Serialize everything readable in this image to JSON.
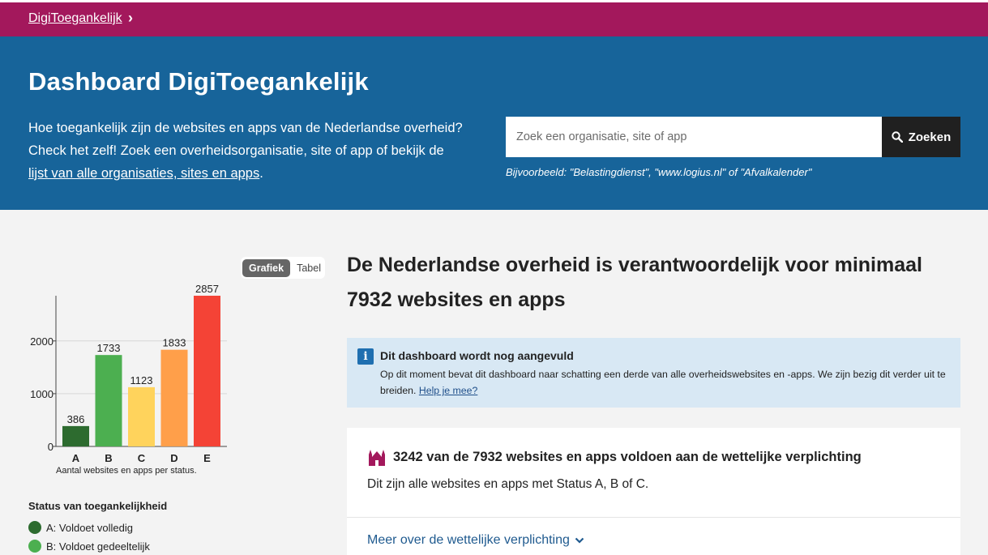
{
  "breadcrumb": {
    "label": "DigiToegankelijk",
    "chevron": "›"
  },
  "hero": {
    "title": "Dashboard DigiToegankelijk",
    "text_before": "Hoe toegankelijk zijn de websites en apps van de Nederlandse overheid? Check het zelf! Zoek een overheidsorganisatie, site of app of bekijk de ",
    "link": "lijst van alle organisaties, sites en apps",
    "text_after": ".",
    "search_placeholder": "Zoek een organisatie, site of app",
    "search_button": "Zoeken",
    "search_example": "Bijvoorbeeld: \"Belastingdienst\", \"www.logius.nl\" of \"Afvalkalender\""
  },
  "view_toggle": {
    "active": "Grafiek",
    "inactive": "Tabel"
  },
  "chart_data": {
    "type": "bar",
    "categories": [
      "A",
      "B",
      "C",
      "D",
      "E"
    ],
    "values": [
      386,
      1733,
      1123,
      1833,
      2857
    ],
    "colors": [
      "#2d6b2f",
      "#4caf50",
      "#ffd35c",
      "#ff9f4a",
      "#f44336"
    ],
    "yticks": [
      0,
      1000,
      2000
    ],
    "ylim": [
      0,
      2857
    ],
    "caption": "Aantal websites en apps per status."
  },
  "legend": {
    "title": "Status van toegankelijkheid",
    "items": [
      {
        "label": "A: Voldoet volledig",
        "color": "#2d6b2f"
      },
      {
        "label": "B: Voldoet gedeeltelijk",
        "color": "#4caf50"
      }
    ]
  },
  "main": {
    "heading_before": "De Nederlandse overheid is verantwoordelijk voor minimaal ",
    "heading_number": "7932",
    "heading_after": " websites en apps"
  },
  "info": {
    "icon": "info-icon",
    "title": "Dit dashboard wordt nog aangevuld",
    "body": "Op dit moment bevat dit dashboard naar schatting een derde van alle overheidswebsites en -apps. We zijn bezig dit verder uit te breiden. ",
    "link": "Help je mee?"
  },
  "card": {
    "icon": "building-icon",
    "title": "3242 van de 7932 websites en apps voldoen aan de wettelijke verplichting",
    "subtitle": "Dit zijn alle websites en apps met Status A, B of C.",
    "link": "Meer over de wettelijke verplichting"
  }
}
